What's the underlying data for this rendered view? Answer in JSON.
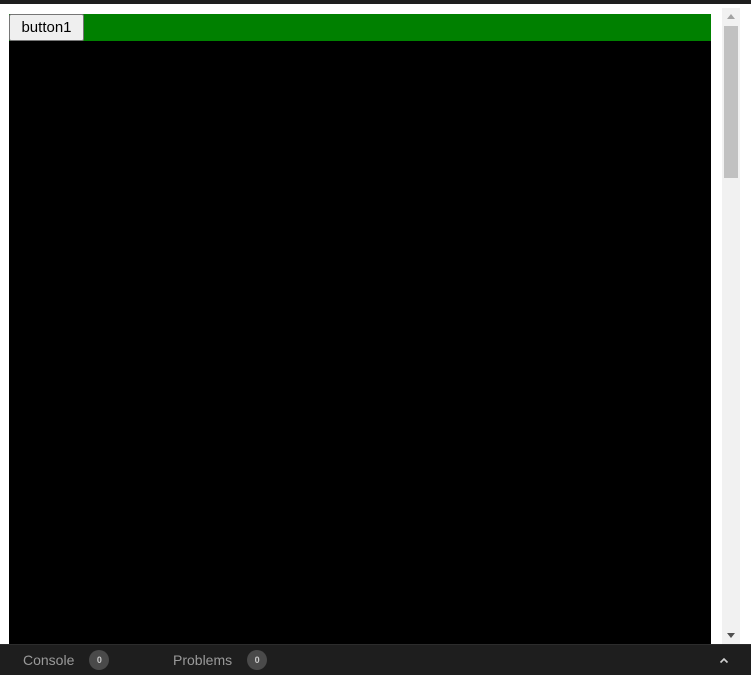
{
  "preview": {
    "button_label": "button1",
    "toolbar_color": "#008000",
    "canvas_color": "#000000"
  },
  "bottom_panel": {
    "tabs": [
      {
        "label": "Console",
        "count": "0"
      },
      {
        "label": "Problems",
        "count": "0"
      }
    ],
    "expand_icon": "chevron-up-icon"
  },
  "icons": {
    "scroll_up": "triangle-up-icon",
    "scroll_down": "triangle-down-icon"
  }
}
